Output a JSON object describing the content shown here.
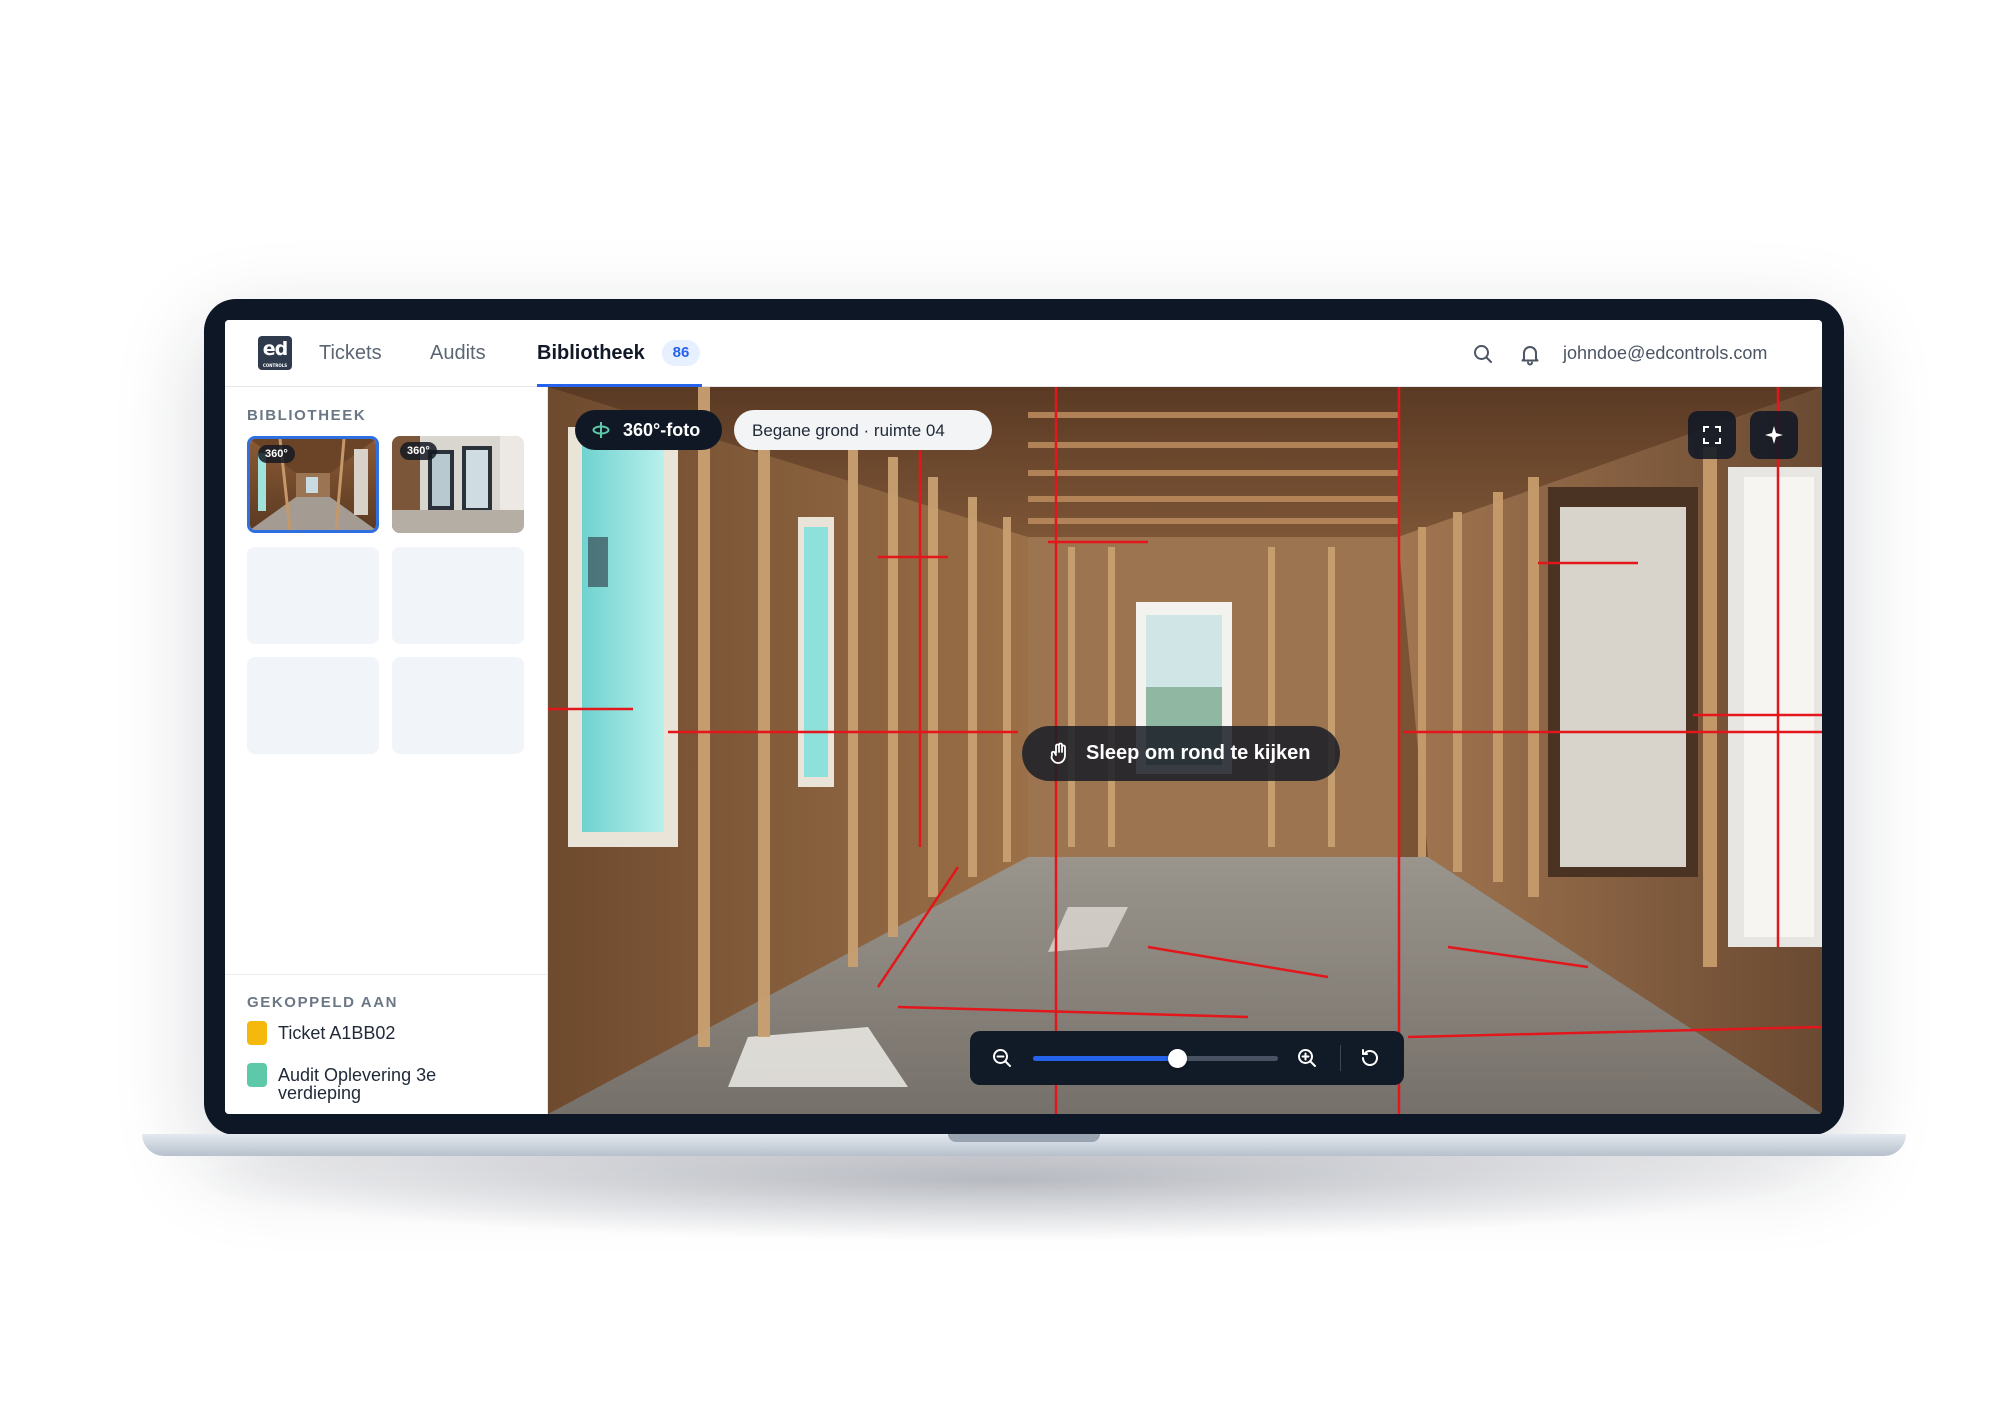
{
  "nav": {
    "logo_text": "ed",
    "logo_sub": "CONTROLS",
    "tabs": [
      {
        "label": "Tickets"
      },
      {
        "label": "Audits"
      },
      {
        "label": "Bibliotheek",
        "badge": "86",
        "active": true
      }
    ],
    "search_icon": "search-icon",
    "bell_icon": "bell-icon",
    "user_email": "johndoe@edcontrols.com"
  },
  "sidebar": {
    "library_label": "BIBLIOTHEEK",
    "thumbnails": [
      {
        "badge": "360°",
        "selected": true
      },
      {
        "badge": "360°",
        "selected": false
      }
    ],
    "linked_label": "GEKOPPELD AAN",
    "linked_items": [
      {
        "label": "Ticket A1BB02",
        "color": "#f5b80c"
      },
      {
        "label": "Audit Oplevering 3e verdieping",
        "color": "#5ec9a8"
      }
    ]
  },
  "viewer": {
    "mode_label": "360°-foto",
    "location_label": "Begane grond · ruimte 04",
    "drag_hint": "Sleep om rond te kijken",
    "zoom_level": 0.59,
    "icons": [
      "rotate-360-icon",
      "fullscreen-icon",
      "compass-icon",
      "hand-icon",
      "zoom-out-icon",
      "zoom-in-icon",
      "reset-icon"
    ]
  },
  "colors": {
    "accent": "#2563eb",
    "frame": "#0e1726",
    "annotation_red": "#e3161b"
  }
}
